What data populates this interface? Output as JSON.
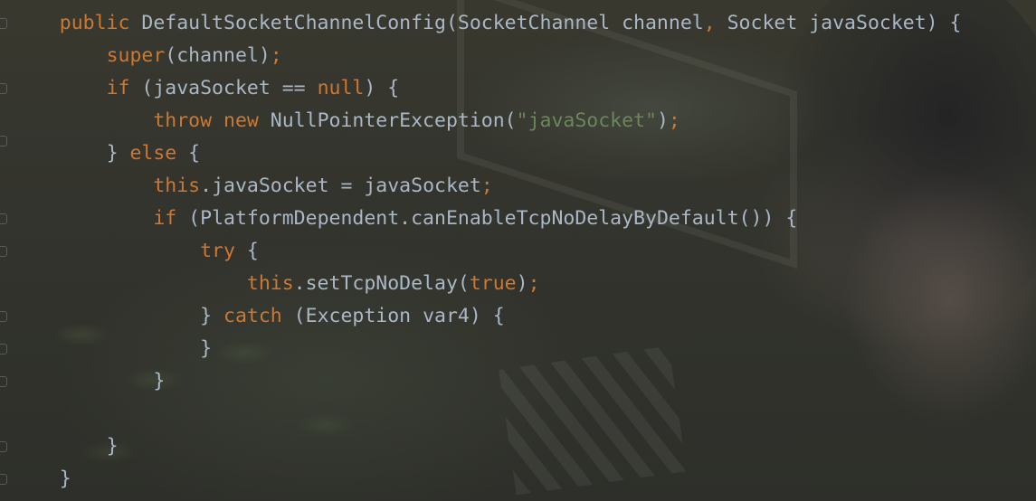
{
  "editor": {
    "language": "java",
    "colors": {
      "background": "#2b2b2b",
      "keyword": "#cc7832",
      "string": "#6a8759",
      "identifier": "#a9b7c6"
    },
    "lines": [
      {
        "indent": "    ",
        "tokens": [
          {
            "type": "kw",
            "text": "public"
          },
          {
            "type": "plain",
            "text": " DefaultSocketChannelConfig(SocketChannel channel"
          },
          {
            "type": "punct",
            "text": ","
          },
          {
            "type": "plain",
            "text": " Socket javaSocket) {"
          }
        ]
      },
      {
        "indent": "        ",
        "tokens": [
          {
            "type": "kw",
            "text": "super"
          },
          {
            "type": "plain",
            "text": "(channel)"
          },
          {
            "type": "punct",
            "text": ";"
          }
        ]
      },
      {
        "indent": "        ",
        "tokens": [
          {
            "type": "kw",
            "text": "if"
          },
          {
            "type": "plain",
            "text": " (javaSocket == "
          },
          {
            "type": "kw",
            "text": "null"
          },
          {
            "type": "plain",
            "text": ") {"
          }
        ]
      },
      {
        "indent": "            ",
        "tokens": [
          {
            "type": "kw",
            "text": "throw new"
          },
          {
            "type": "plain",
            "text": " NullPointerException("
          },
          {
            "type": "str",
            "text": "\"javaSocket\""
          },
          {
            "type": "plain",
            "text": ")"
          },
          {
            "type": "punct",
            "text": ";"
          }
        ]
      },
      {
        "indent": "        ",
        "tokens": [
          {
            "type": "plain",
            "text": "} "
          },
          {
            "type": "kw",
            "text": "else"
          },
          {
            "type": "plain",
            "text": " {"
          }
        ]
      },
      {
        "indent": "            ",
        "tokens": [
          {
            "type": "kw",
            "text": "this"
          },
          {
            "type": "plain",
            "text": ".javaSocket = javaSocket"
          },
          {
            "type": "punct",
            "text": ";"
          }
        ]
      },
      {
        "indent": "            ",
        "tokens": [
          {
            "type": "kw",
            "text": "if"
          },
          {
            "type": "plain",
            "text": " (PlatformDependent.canEnableTcpNoDelayByDefault()) {"
          }
        ]
      },
      {
        "indent": "                ",
        "tokens": [
          {
            "type": "kw",
            "text": "try"
          },
          {
            "type": "plain",
            "text": " {"
          }
        ]
      },
      {
        "indent": "                    ",
        "tokens": [
          {
            "type": "kw",
            "text": "this"
          },
          {
            "type": "plain",
            "text": ".setTcpNoDelay("
          },
          {
            "type": "kw",
            "text": "true"
          },
          {
            "type": "plain",
            "text": ")"
          },
          {
            "type": "punct",
            "text": ";"
          }
        ]
      },
      {
        "indent": "                ",
        "tokens": [
          {
            "type": "plain",
            "text": "} "
          },
          {
            "type": "kw",
            "text": "catch"
          },
          {
            "type": "plain",
            "text": " (Exception var4) {"
          }
        ]
      },
      {
        "indent": "                ",
        "tokens": [
          {
            "type": "plain",
            "text": "}"
          }
        ]
      },
      {
        "indent": "            ",
        "tokens": [
          {
            "type": "plain",
            "text": "}"
          }
        ]
      },
      {
        "indent": "",
        "tokens": []
      },
      {
        "indent": "        ",
        "tokens": [
          {
            "type": "plain",
            "text": "}"
          }
        ]
      },
      {
        "indent": "    ",
        "tokens": [
          {
            "type": "plain",
            "text": "}"
          }
        ]
      }
    ]
  }
}
